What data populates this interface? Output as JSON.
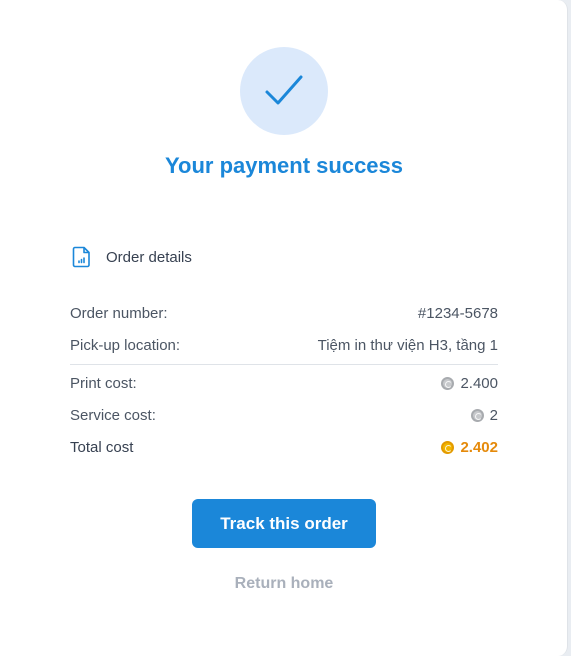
{
  "title": "Your payment success",
  "order_details": {
    "heading": "Order details",
    "icon": "document-chart-icon"
  },
  "rows": {
    "order_number": {
      "label": "Order number:",
      "value": "#1234-5678"
    },
    "pickup_location": {
      "label": "Pick-up location:",
      "value": "Tiệm in thư viện H3, tầng 1"
    },
    "print_cost": {
      "label": "Print cost:",
      "value": "2.400"
    },
    "service_cost": {
      "label": "Service cost:",
      "value": "2"
    },
    "total_cost": {
      "label": "Total cost",
      "value": "2.402"
    }
  },
  "buttons": {
    "track": "Track this order",
    "return_home": "Return home"
  },
  "colors": {
    "primary": "#1b87d9",
    "total_accent": "#e58a0b",
    "check_bg": "#dbe9fb"
  }
}
